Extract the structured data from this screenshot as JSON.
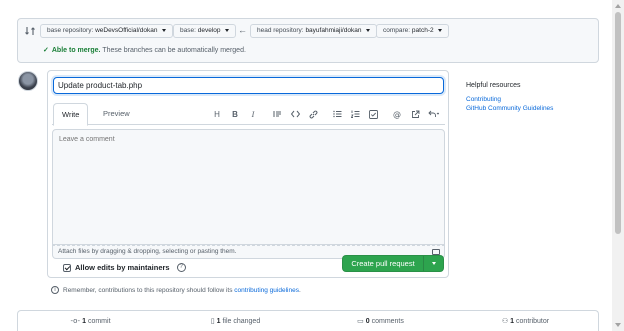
{
  "compare": {
    "base_repository_label": "base repository:",
    "base_repository_value": "weDevsOfficial/dokan",
    "base_label": "base:",
    "base_value": "develop",
    "head_repository_label": "head repository:",
    "head_repository_value": "bayufahmiaji/dokan",
    "compare_label": "compare:",
    "compare_value": "patch-2",
    "merge_status": "Able to merge.",
    "merge_detail": "These branches can be automatically merged."
  },
  "form": {
    "title_value": "Update product-tab.php",
    "tabs": [
      "Write",
      "Preview"
    ],
    "toolbar_icons": [
      "heading-icon",
      "bold-icon",
      "italic-icon",
      "quote-icon",
      "code-icon",
      "link-icon",
      "bulleted-list-icon",
      "numbered-list-icon",
      "task-list-icon",
      "mention-icon",
      "reference-icon",
      "reply-icon"
    ],
    "comment_placeholder": "Leave a comment",
    "attach_text": "Attach files by dragging & dropping, selecting or pasting them.",
    "allow_edits_label": "Allow edits by maintainers",
    "create_button_label": "Create pull request"
  },
  "remember": {
    "text": "Remember, contributions to this repository should follow its",
    "link": "contributing guidelines",
    "suffix": "."
  },
  "sidebar": {
    "title": "Helpful resources",
    "links": [
      "Contributing",
      "GitHub Community Guidelines"
    ]
  },
  "stats": {
    "commits_count": "1",
    "commits_label": "commit",
    "files_count": "1",
    "files_label": "file changed",
    "comments_count": "0",
    "comments_label": "comments",
    "contributors_count": "1",
    "contributors_label": "contributor"
  },
  "colors": {
    "accent": "#0969da",
    "success": "#2da44e",
    "merge_ok": "#1a7f37"
  }
}
